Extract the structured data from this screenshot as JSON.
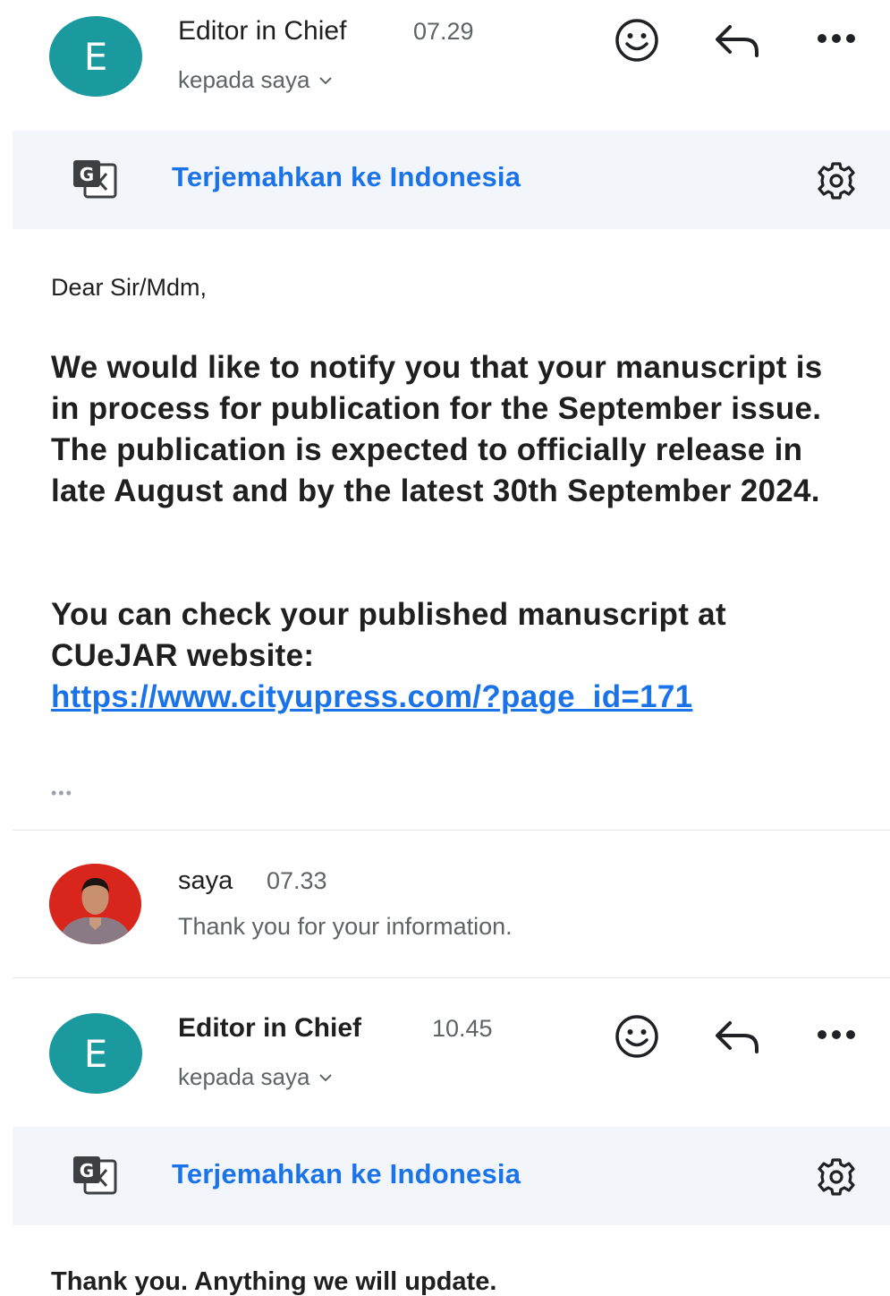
{
  "messages": [
    {
      "avatar_letter": "E",
      "sender": "Editor in Chief",
      "time": "07.29",
      "to": "kepada saya",
      "translate_label": "Terjemahkan ke Indonesia",
      "greeting": "Dear Sir/Mdm,",
      "paragraph1": "We would like to notify you that your manuscript is in process for publication for the September issue. The publication is expected to officially release in late August and by the latest 30th September 2024.",
      "paragraph2": "You can check your published manuscript at CUeJAR website:",
      "link": "https://www.cityupress.com/?page_id=171",
      "ellipsis": "•••"
    },
    {
      "sender": "saya",
      "time": "07.33",
      "snippet": "Thank you for your information."
    },
    {
      "avatar_letter": "E",
      "sender": "Editor in Chief",
      "time": "10.45",
      "to": "kepada saya",
      "translate_label": "Terjemahkan ke Indonesia",
      "body": "Thank you. Anything we will update."
    }
  ],
  "icons": {
    "emoji": "emoji-icon",
    "reply": "reply-icon",
    "more": "more-icon",
    "translate": "google-translate-icon",
    "settings": "gear-icon",
    "chevron": "chevron-down-icon"
  },
  "colors": {
    "avatar": "#1a9a9e",
    "link": "#1a73e8",
    "translate_bar": "#f2f5fa",
    "secondary_text": "#5f6368"
  }
}
